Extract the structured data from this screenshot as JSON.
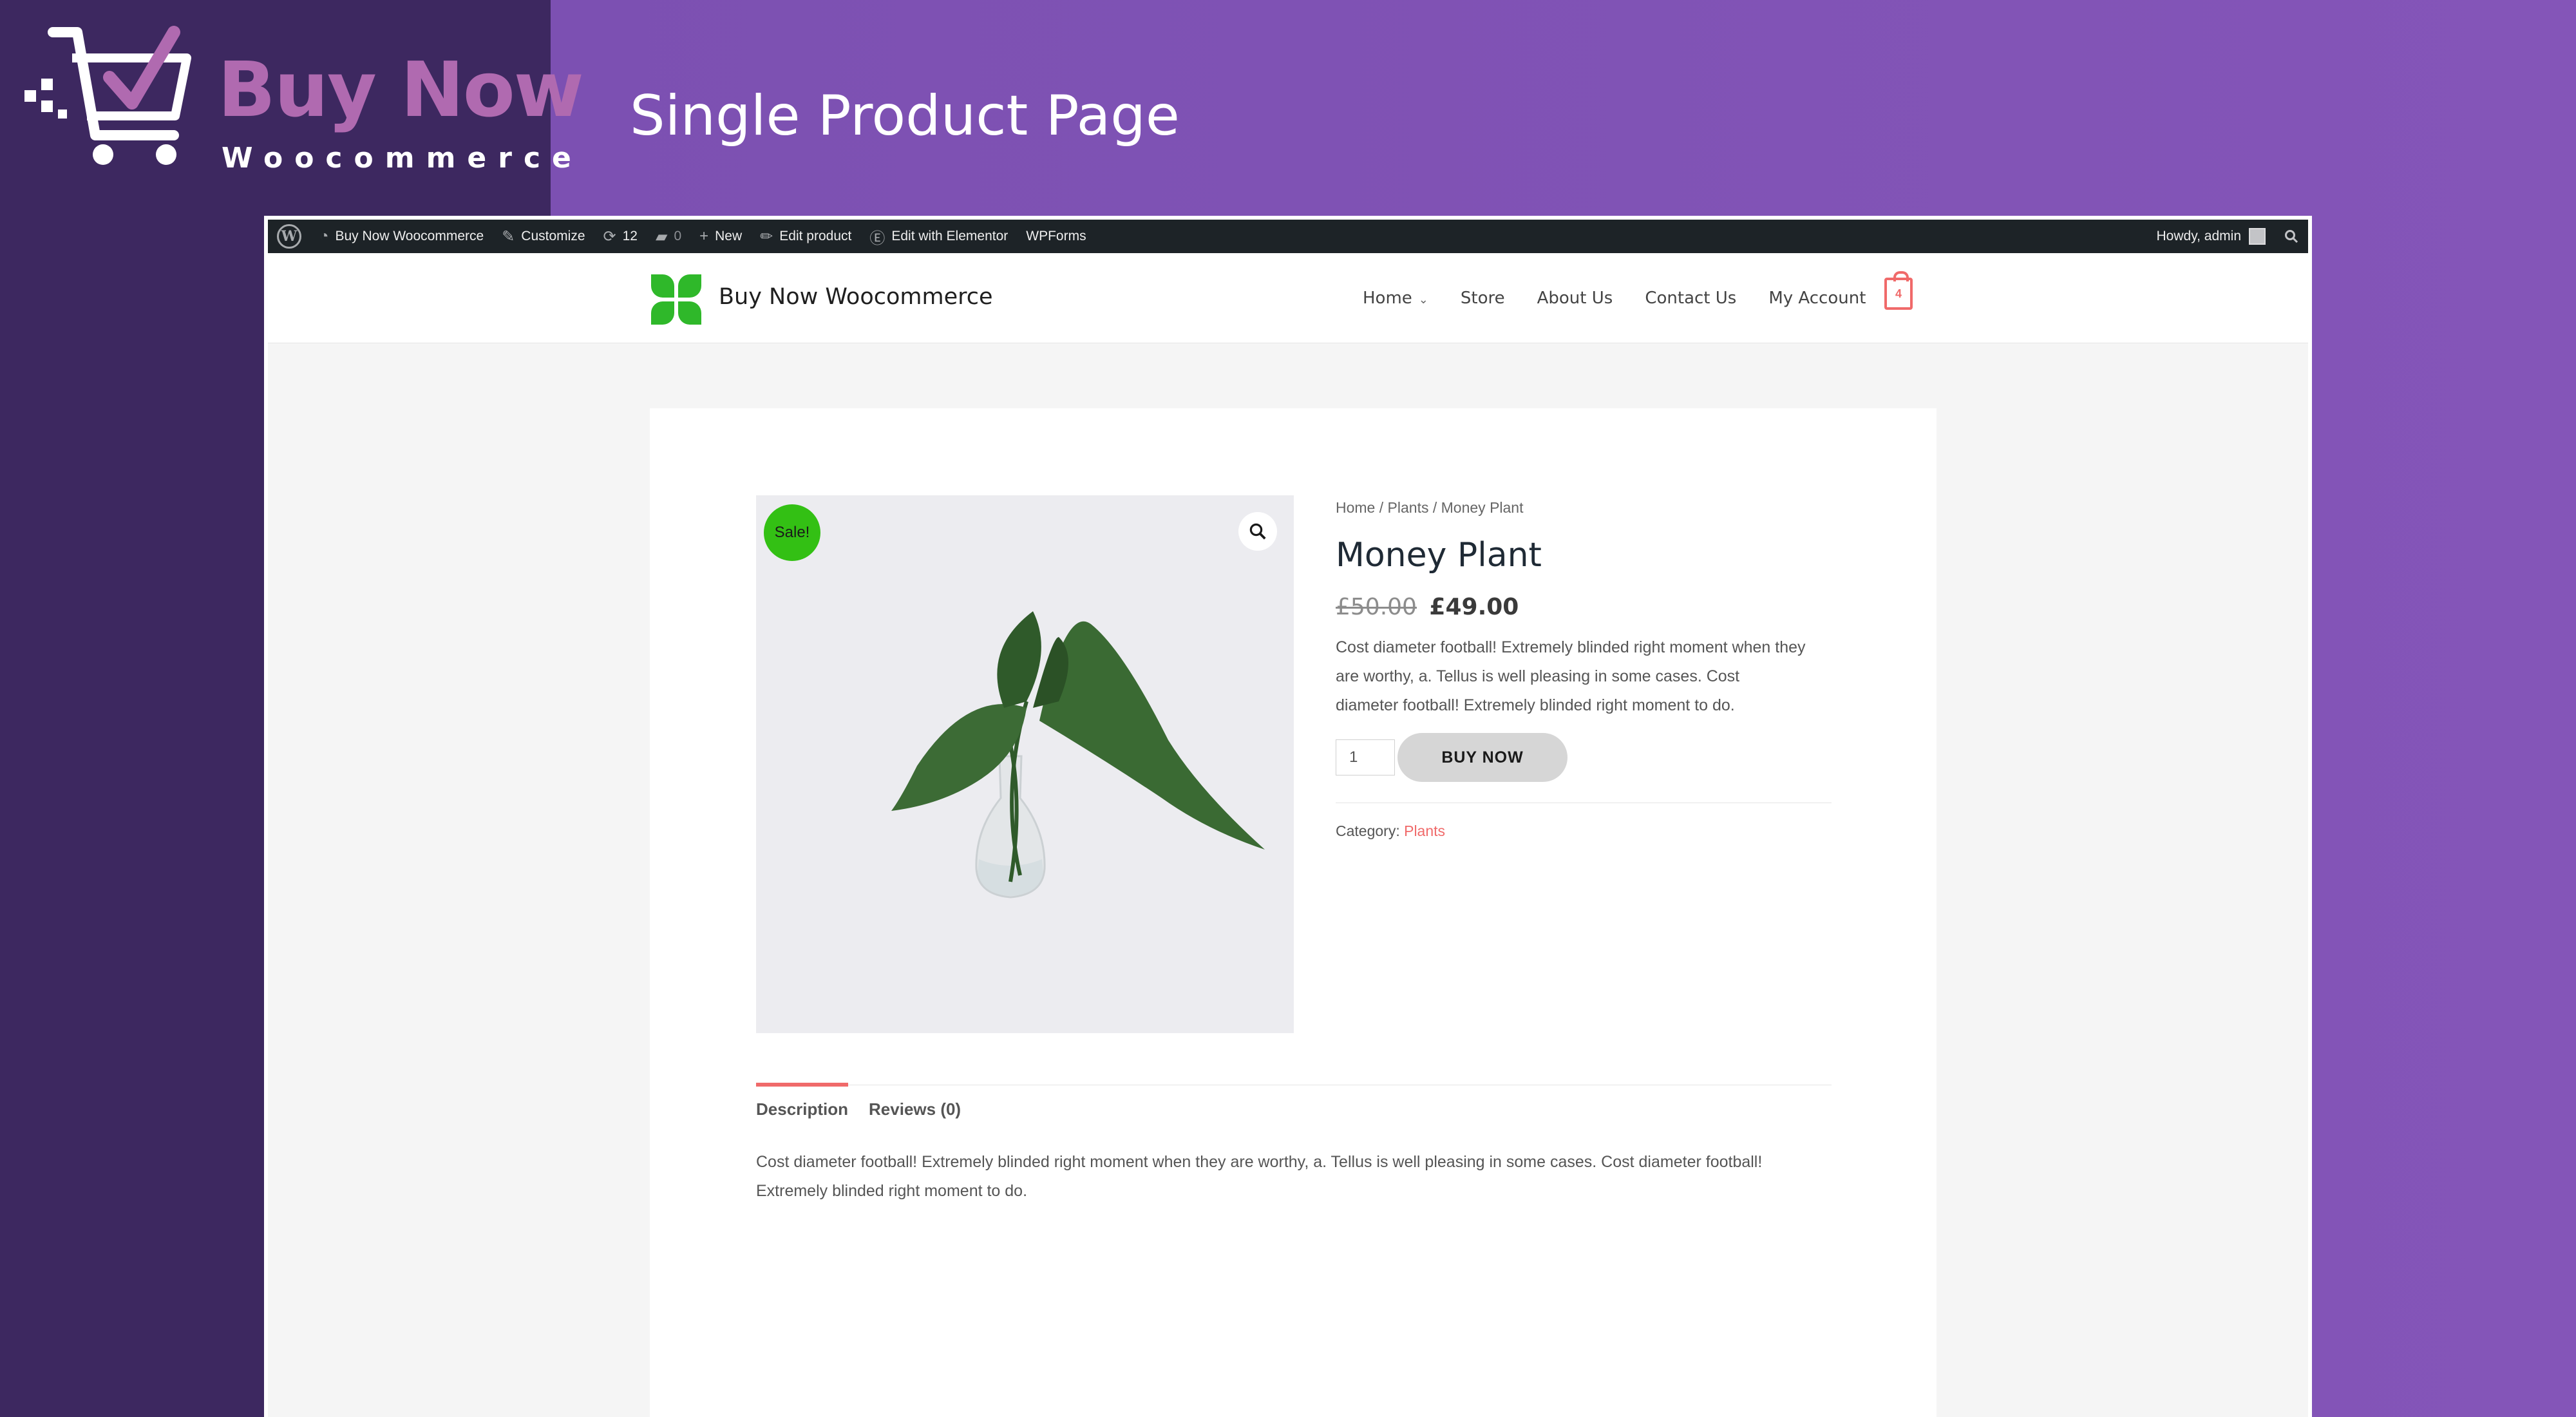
{
  "brand": {
    "title": "Buy Now",
    "subtitle": "Woocommerce"
  },
  "page_heading": "Single Product Page",
  "admin_bar": {
    "site_name": "Buy Now Woocommerce",
    "customize": "Customize",
    "updates_count": "12",
    "comments_count": "0",
    "new": "New",
    "edit_product": "Edit product",
    "edit_elementor": "Edit with Elementor",
    "wpforms": "WPForms",
    "howdy": "Howdy, admin"
  },
  "header": {
    "site_name": "Buy Now Woocommerce",
    "nav": [
      "Home",
      "Store",
      "About Us",
      "Contact Us",
      "My Account"
    ],
    "cart_count": "4"
  },
  "product": {
    "sale_badge": "Sale!",
    "breadcrumb": [
      "Home",
      "Plants",
      "Money Plant"
    ],
    "title": "Money Plant",
    "price_old": "£50.00",
    "price_new": "£49.00",
    "short_description": "Cost diameter football! Extremely blinded right moment when they are worthy, a. Tellus is well pleasing in some cases. Cost diameter football! Extremely blinded right moment to do.",
    "quantity": "1",
    "buy_button": "BUY NOW",
    "category_label": "Category:",
    "category": "Plants"
  },
  "tabs": {
    "items": [
      "Description",
      "Reviews (0)"
    ],
    "description": "Cost diameter football! Extremely blinded right moment when they are worthy, a. Tellus is well pleasing in some cases. Cost diameter football! Extremely blinded right moment to do."
  },
  "colors": {
    "accent": "#f06a6a",
    "sale": "#33c014",
    "background_purple": "#8455b8",
    "brand_panel": "#3d2860"
  }
}
